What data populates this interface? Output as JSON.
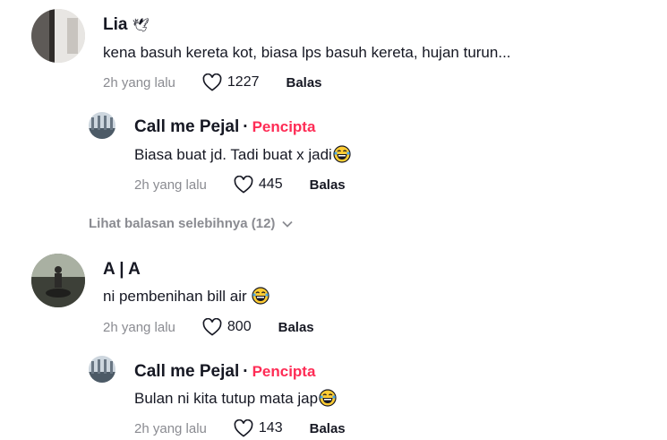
{
  "comments": [
    {
      "name": "Lia",
      "name_emoji": "🕊",
      "text": "kena basuh kereta kot, biasa lps basuh kereta, hujan turun...",
      "time": "2h yang lalu",
      "likes": "1227",
      "reply_label": "Balas"
    },
    {
      "name": "A | A",
      "text": "ni pembenihan bill air ",
      "time": "2h yang lalu",
      "likes": "800",
      "reply_label": "Balas"
    }
  ],
  "replies": [
    {
      "name": "Call me Pejal",
      "separator": "·",
      "badge": "Pencipta",
      "text": "Biasa buat jd. Tadi buat x jadi",
      "time": "2h yang lalu",
      "likes": "445",
      "reply_label": "Balas"
    },
    {
      "name": "Call me Pejal",
      "separator": "·",
      "badge": "Pencipta",
      "text": "Bulan ni kita tutup mata jap",
      "time": "2h yang lalu",
      "likes": "143",
      "reply_label": "Balas"
    }
  ],
  "view_more": "Lihat balasan selebihnya (12)",
  "icons": {
    "like": "heart-outline-icon",
    "emoji": "laughing-tears-emoji",
    "expand": "chevron-down-icon"
  },
  "colors": {
    "creator_badge": "#fe2c55",
    "muted": "#8a8b91",
    "text": "#161823"
  }
}
